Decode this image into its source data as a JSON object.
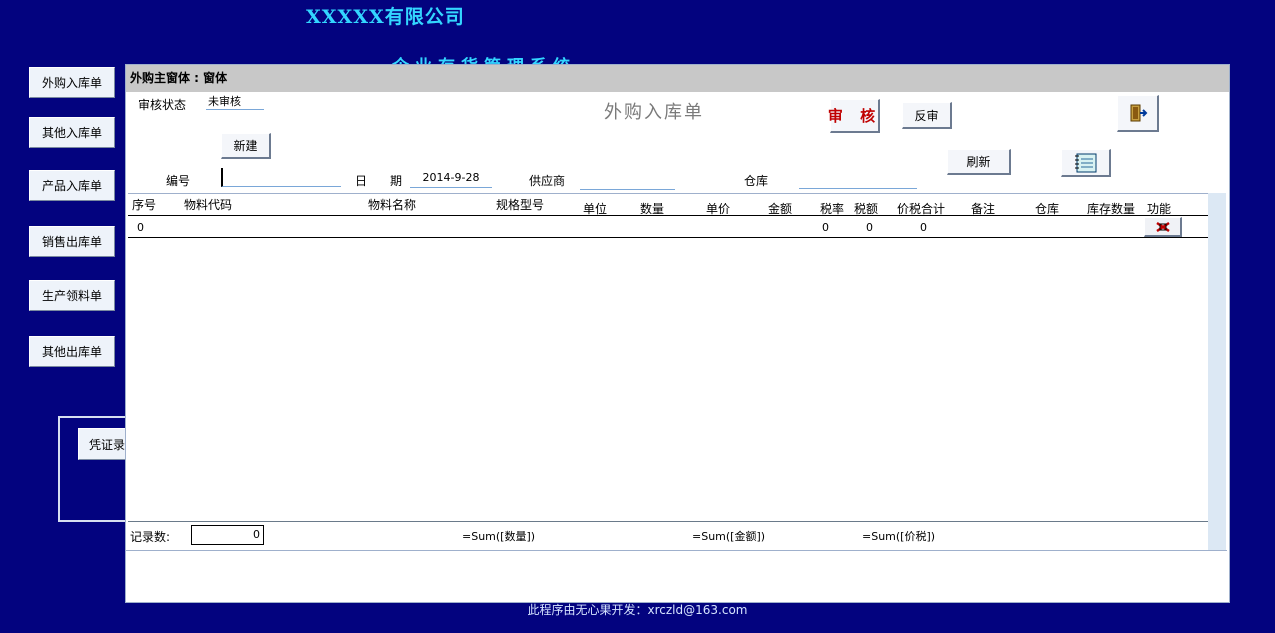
{
  "header": {
    "company": "XXXXX有限公司",
    "system_partial": "企业存货管理系统"
  },
  "nav": [
    {
      "label": "外购入库单"
    },
    {
      "label": "其他入库单"
    },
    {
      "label": "产品入库单"
    },
    {
      "label": "销售出库单"
    },
    {
      "label": "生产领料单"
    },
    {
      "label": "其他出库单"
    }
  ],
  "voucher": {
    "label": "凭证录"
  },
  "window": {
    "title": "外购主窗体 : 窗体",
    "form_title": "外购入库单",
    "status_label": "审核状态",
    "status_value": "未审核",
    "buttons": {
      "new": "新建",
      "audit": "审 核",
      "unaudit": "反审",
      "refresh": "刷新"
    },
    "fields": {
      "number_label": "编号",
      "number_value": "",
      "date_label_1": "日",
      "date_label_2": "期",
      "date_value": "2014-9-28",
      "supplier_label": "供应商",
      "supplier_value": "",
      "warehouse_label": "仓库",
      "warehouse_value": ""
    },
    "grid": {
      "columns": [
        "序号",
        "物料代码",
        "物料名称",
        "规格型号",
        "单位",
        "数量",
        "单价",
        "金额",
        "税率",
        "税额",
        "价税合计",
        "备注",
        "仓库",
        "库存数量",
        "功能"
      ],
      "row": {
        "seq": "0",
        "tax_rate": "0",
        "tax_amount": "0",
        "total": "0"
      }
    },
    "footer": {
      "count_label": "记录数:",
      "count_value": "0",
      "sum_qty": "=Sum([数量])",
      "sum_amount": "=Sum([金额])",
      "sum_tax": "=Sum([价税])"
    }
  },
  "credit": "此程序由无心果开发：xrczld@163.com",
  "icons": {
    "exit": "exit-door-icon",
    "notebook": "notebook-icon",
    "delete": "delete-row-icon"
  },
  "colors": {
    "background": "#03037f",
    "title_text": "#33d6ff",
    "audit_text": "#c00000"
  }
}
